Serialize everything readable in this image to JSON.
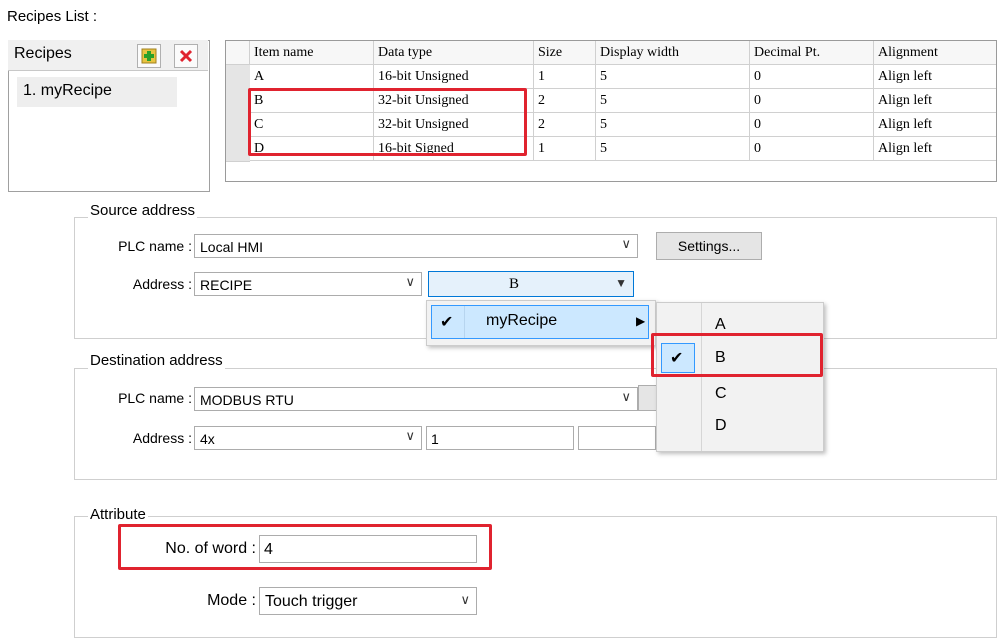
{
  "recipes_list": {
    "label": "Recipes List :",
    "header": "Recipes",
    "items": [
      "1. myRecipe"
    ]
  },
  "table": {
    "columns": [
      "Item name",
      "Data type",
      "Size",
      "Display width",
      "Decimal Pt.",
      "Alignment"
    ],
    "rows": [
      [
        "A",
        "16-bit Unsigned",
        "1",
        "5",
        "0",
        "Align left"
      ],
      [
        "B",
        "32-bit Unsigned",
        "2",
        "5",
        "0",
        "Align left"
      ],
      [
        "C",
        "32-bit Unsigned",
        "2",
        "5",
        "0",
        "Align left"
      ],
      [
        "D",
        "16-bit Signed",
        "1",
        "5",
        "0",
        "Align left"
      ]
    ]
  },
  "source": {
    "title": "Source address",
    "plc_label": "PLC name :",
    "plc_value": "Local HMI",
    "settings_label": "Settings...",
    "address_label": "Address :",
    "address_value": "RECIPE",
    "item_value": "B"
  },
  "destination": {
    "title": "Destination address",
    "plc_label": "PLC name :",
    "plc_value": "MODBUS RTU",
    "address_label": "Address :",
    "address_value": "4x",
    "address_number": "1"
  },
  "attribute": {
    "title": "Attribute",
    "words_label": "No. of word :",
    "words_value": "4",
    "mode_label": "Mode :",
    "mode_value": "Touch trigger"
  },
  "menu": {
    "recipe": "myRecipe",
    "items": [
      "A",
      "B",
      "C",
      "D"
    ]
  },
  "colors": {
    "highlight_red": "#e0232f",
    "menu_selected": "#cce8ff",
    "menu_border": "#3399ff"
  }
}
